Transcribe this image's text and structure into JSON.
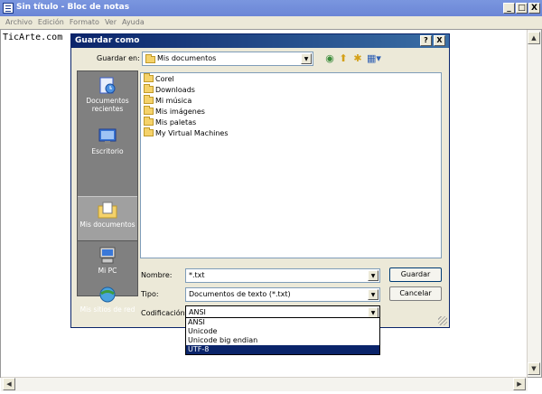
{
  "notepad": {
    "title": "Sin título - Bloc de notas",
    "menu": [
      "Archivo",
      "Edición",
      "Formato",
      "Ver",
      "Ayuda"
    ],
    "content": "TicArte.com",
    "caption_buttons": [
      "_",
      "□",
      "X"
    ]
  },
  "dialog": {
    "title": "Guardar como",
    "help": "?",
    "close": "X",
    "save_in_label": "Guardar en:",
    "save_in_value": "Mis documentos",
    "places": [
      {
        "label": "Documentos recientes",
        "icon": "recent-documents-icon"
      },
      {
        "label": "Escritorio",
        "icon": "desktop-icon"
      },
      {
        "label": "Mis documentos",
        "icon": "my-documents-icon"
      },
      {
        "label": "Mi PC",
        "icon": "my-computer-icon"
      },
      {
        "label": "Mis sitios de red",
        "icon": "network-places-icon"
      }
    ],
    "files": [
      "Corel",
      "Downloads",
      "Mi música",
      "Mis imágenes",
      "Mis paletas",
      "My Virtual Machines"
    ],
    "name_label": "Nombre:",
    "name_value": "*.txt",
    "type_label": "Tipo:",
    "type_value": "Documentos de texto (*.txt)",
    "encoding_label": "Codificación:",
    "encoding_value": "ANSI",
    "encoding_options": [
      "ANSI",
      "Unicode",
      "Unicode big endian",
      "UTF-8"
    ],
    "encoding_highlighted": "UTF-8",
    "save_button": "Guardar",
    "cancel_button": "Cancelar"
  },
  "colors": {
    "dialog_title": "#0a246a",
    "notepad_title": "#7a96df",
    "dialog_bg": "#ece9d8",
    "places_bar": "#808080",
    "selection": "#0a246a"
  }
}
